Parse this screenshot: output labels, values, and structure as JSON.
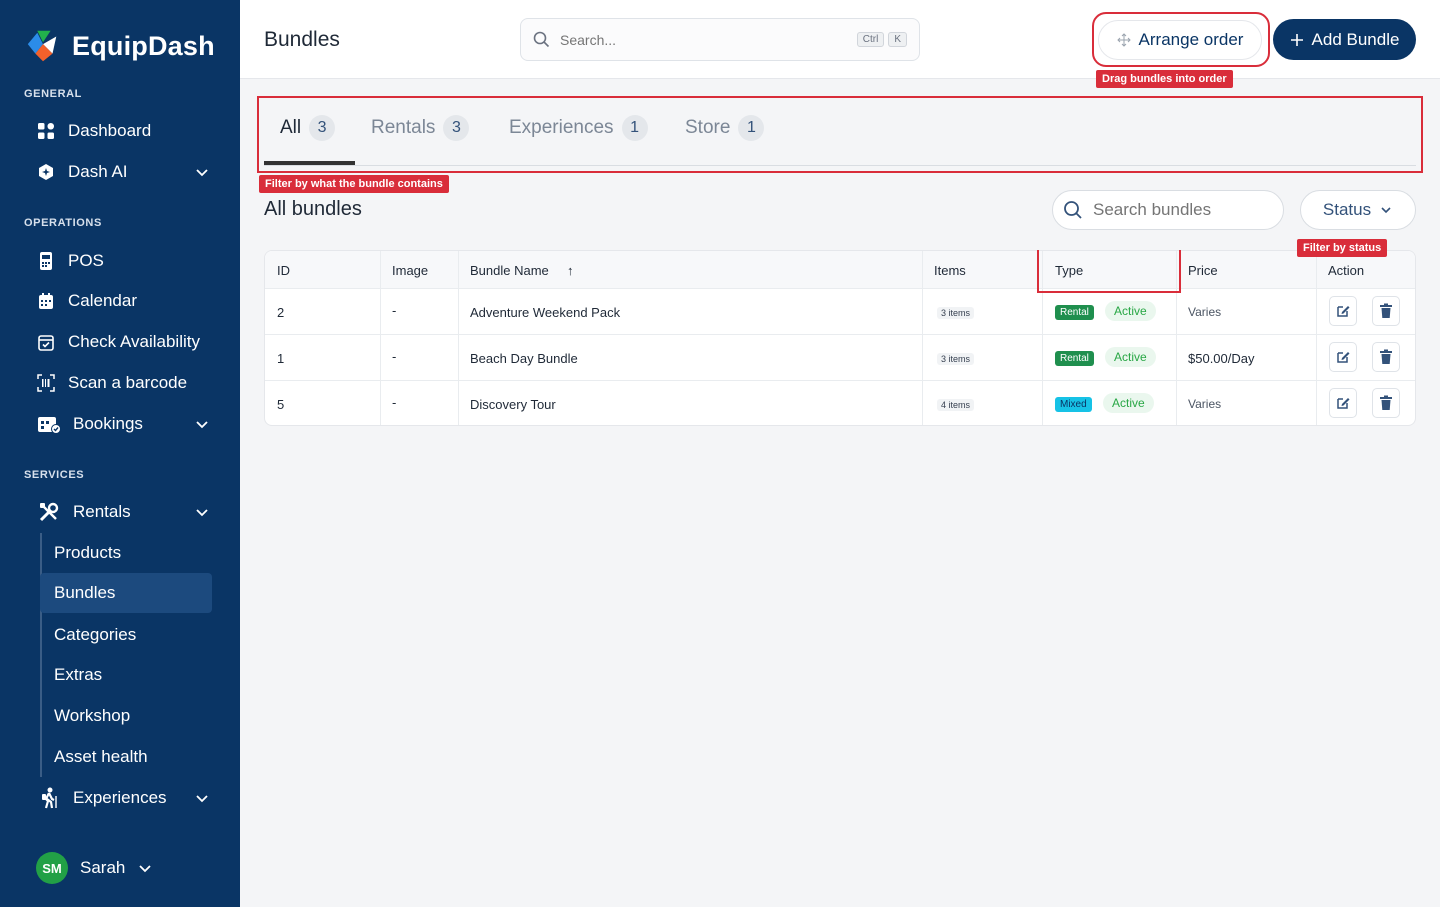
{
  "brand": {
    "name": "EquipDash"
  },
  "sidebar": {
    "sections": {
      "general": "GENERAL",
      "operations": "OPERATIONS",
      "services": "SERVICES"
    },
    "general_items": [
      {
        "label": "Dashboard",
        "icon": "grid-icon"
      },
      {
        "label": "Dash AI",
        "icon": "ai-shield-icon"
      }
    ],
    "operations_items": [
      {
        "label": "POS",
        "icon": "pos-terminal-icon"
      },
      {
        "label": "Calendar",
        "icon": "calendar-icon"
      },
      {
        "label": "Check Availability",
        "icon": "calendar-check-icon"
      },
      {
        "label": "Scan a barcode",
        "icon": "barcode-scan-icon"
      },
      {
        "label": "Bookings",
        "icon": "bookings-icon"
      }
    ],
    "services_items": [
      {
        "label": "Rentals",
        "icon": "tools-icon"
      },
      {
        "label": "Experiences",
        "icon": "hiker-icon"
      }
    ],
    "rentals_subitems": [
      "Products",
      "Bundles",
      "Categories",
      "Extras",
      "Workshop",
      "Asset health"
    ],
    "user": {
      "initials": "SM",
      "name": "Sarah"
    }
  },
  "header": {
    "title": "Bundles",
    "search_placeholder": "Search...",
    "shortcut": [
      "Ctrl",
      "K"
    ],
    "arrange_label": "Arrange order",
    "add_label": "Add Bundle"
  },
  "tooltips": {
    "arrange": "Drag bundles into order",
    "tabs": "Filter by what the bundle contains",
    "status": "Filter by status"
  },
  "tabs": [
    {
      "label": "All",
      "count": "3"
    },
    {
      "label": "Rentals",
      "count": "3"
    },
    {
      "label": "Experiences",
      "count": "1"
    },
    {
      "label": "Store",
      "count": "1"
    }
  ],
  "list": {
    "heading": "All bundles",
    "search_placeholder": "Search bundles",
    "status_label": "Status"
  },
  "table": {
    "columns": [
      "ID",
      "Image",
      "Bundle Name",
      "Items",
      "Type",
      "Price",
      "Action"
    ],
    "sort_indicator": "↑",
    "rows": [
      {
        "id": "2",
        "image": "-",
        "name": "Adventure Weekend Pack",
        "items": "3 items",
        "type": "Rental",
        "status": "Active",
        "price": "Varies"
      },
      {
        "id": "1",
        "image": "-",
        "name": "Beach Day Bundle",
        "items": "3 items",
        "type": "Rental",
        "status": "Active",
        "price": "$50.00/Day"
      },
      {
        "id": "5",
        "image": "-",
        "name": "Discovery Tour",
        "items": "4 items",
        "type": "Mixed",
        "status": "Active",
        "price": "Varies"
      }
    ]
  },
  "colors": {
    "sidebar": "#0a3565",
    "accent_red": "#d92d3a",
    "rental_green": "#1f8f4e",
    "mixed_cyan": "#16c2e6"
  }
}
